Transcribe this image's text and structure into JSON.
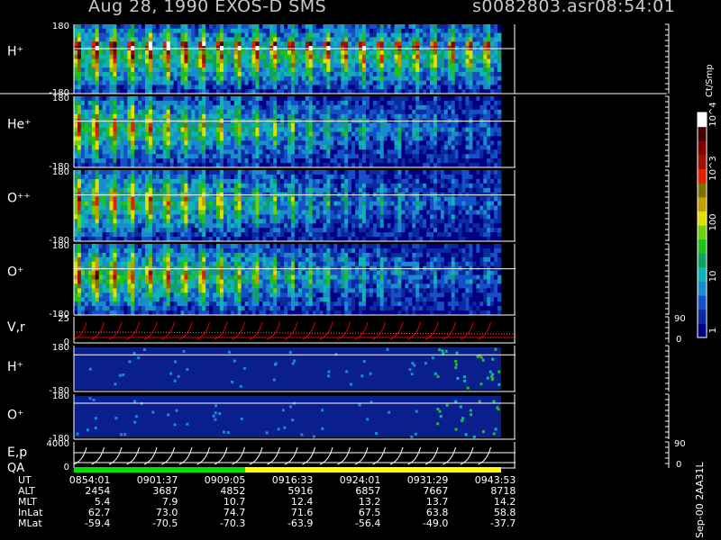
{
  "header": {
    "title": "Aug 28, 1990   EXOS-D SMS",
    "file": "s0082803.asr",
    "time": "08:54:01"
  },
  "colorbar": {
    "unit": "Ct/Smp",
    "ticks": [
      "1",
      "10",
      "100",
      "10^3",
      "10^4"
    ],
    "colors": [
      "#000080",
      "#0a2aa0",
      "#1550c8",
      "#1a8ccc",
      "#10b4b4",
      "#10a060",
      "#20c020",
      "#70d010",
      "#e0e000",
      "#c0a000",
      "#807000",
      "#e02000",
      "#a01000",
      "#800000",
      "#400000",
      "#ffffff"
    ]
  },
  "footer_label": "Sep-00  2AA31L",
  "chart_data": {
    "type": "heatmap",
    "panels": [
      {
        "name": "H+",
        "ytop": "180",
        "ybottom": "-180",
        "kind": "spectrogram",
        "intensity": [
          2.6,
          2.6,
          2.5,
          2.5,
          2.5,
          2.5,
          2.4,
          2.4,
          2.3,
          2.3,
          2.3,
          2.2,
          2.2,
          2.2,
          2.2,
          2.1,
          2.1,
          2.1,
          2.1,
          2.0,
          2.0,
          2.0,
          2.0,
          1.9
        ]
      },
      {
        "name": "He+",
        "ytop": "180",
        "ybottom": "-180",
        "kind": "spectrogram",
        "intensity": [
          2.4,
          2.4,
          2.3,
          2.3,
          2.2,
          2.1,
          2.0,
          1.9,
          1.8,
          1.7,
          1.6,
          1.5,
          1.4,
          1.3,
          1.2,
          1.1,
          1.0,
          0.9,
          0.9,
          0.8,
          0.8,
          0.7,
          0.7,
          0.7
        ]
      },
      {
        "name": "O++",
        "ytop": "180",
        "ybottom": "-180",
        "kind": "spectrogram",
        "intensity": [
          2.5,
          2.4,
          2.4,
          2.3,
          2.3,
          2.2,
          2.1,
          2.0,
          1.9,
          1.7,
          1.6,
          1.5,
          1.3,
          1.2,
          1.1,
          1.0,
          0.9,
          0.9,
          0.8,
          0.7,
          0.7,
          0.6,
          0.6,
          0.6
        ]
      },
      {
        "name": "O+",
        "ytop": "180",
        "ybottom": "-180",
        "kind": "spectrogram",
        "intensity": [
          2.6,
          2.5,
          2.5,
          2.4,
          2.4,
          2.3,
          2.2,
          2.1,
          2.0,
          1.8,
          1.7,
          1.6,
          1.4,
          1.3,
          1.2,
          1.1,
          1.0,
          0.9,
          0.9,
          0.8,
          0.7,
          0.7,
          0.6,
          0.6
        ]
      },
      {
        "name": "V,r",
        "ytop": "25",
        "ybottom": "0",
        "right_top": "90",
        "right_bottom": "0",
        "kind": "line"
      },
      {
        "name": "H+",
        "ytop": "180",
        "ybottom": "-180",
        "kind": "spectrogram-low"
      },
      {
        "name": "O+",
        "ytop": "180",
        "ybottom": "-180",
        "kind": "spectrogram-low"
      },
      {
        "name": "E,p",
        "ytop": "4000",
        "ybottom": "0",
        "right_top": "90",
        "right_bottom": "0",
        "kind": "line"
      }
    ],
    "qa": {
      "label": "QA",
      "segments": [
        {
          "color": "#00e000",
          "to": "0916:33"
        },
        {
          "color": "#ffff00",
          "to": "0943:53"
        }
      ]
    },
    "ephemeris": {
      "rows": [
        {
          "label": "UT",
          "values": [
            "0854:01",
            "0901:37",
            "0909:05",
            "0916:33",
            "0924:01",
            "0931:29",
            "0943:53"
          ]
        },
        {
          "label": "ALT",
          "values": [
            "2454",
            "3687",
            "4852",
            "5916",
            "6857",
            "7667",
            "8718"
          ]
        },
        {
          "label": "MLT",
          "values": [
            "5.4",
            "7.9",
            "10.7",
            "12.4",
            "13.2",
            "13.7",
            "14.2"
          ]
        },
        {
          "label": "InLat",
          "values": [
            "62.7",
            "73.0",
            "74.7",
            "71.6",
            "67.5",
            "63.8",
            "58.8"
          ]
        },
        {
          "label": "MLat",
          "values": [
            "-59.4",
            "-70.5",
            "-70.3",
            "-63.9",
            "-56.4",
            "-49.0",
            "-37.7"
          ]
        }
      ]
    }
  }
}
